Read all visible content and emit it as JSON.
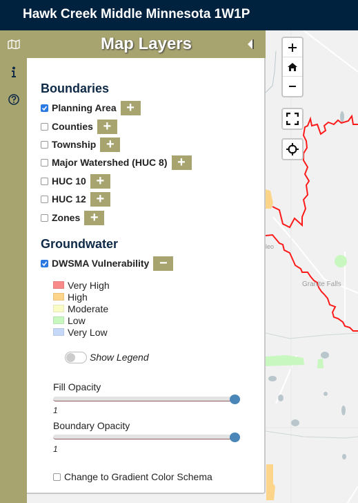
{
  "app": {
    "title": "Hawk Creek Middle Minnesota 1W1P"
  },
  "sidebar_icons": [
    {
      "name": "map-icon",
      "label": "Map Layers"
    },
    {
      "name": "info-icon",
      "label": "Info"
    },
    {
      "name": "help-icon",
      "label": "Help"
    }
  ],
  "panel": {
    "title": "Map Layers",
    "sections": {
      "boundaries": {
        "title": "Boundaries",
        "layers": [
          {
            "label": "Planning Area",
            "checked": true,
            "button": "+"
          },
          {
            "label": "Counties",
            "checked": false,
            "button": "+"
          },
          {
            "label": "Township",
            "checked": false,
            "button": "+"
          },
          {
            "label": "Major Watershed (HUC 8)",
            "checked": false,
            "button": "+"
          },
          {
            "label": "HUC 10",
            "checked": false,
            "button": "+"
          },
          {
            "label": "HUC 12",
            "checked": false,
            "button": "+"
          },
          {
            "label": "Zones",
            "checked": false,
            "button": "+"
          }
        ]
      },
      "groundwater": {
        "title": "Groundwater",
        "layers": [
          {
            "label": "DWSMA Vulnerability",
            "checked": true,
            "button": "−"
          }
        ],
        "legend": [
          {
            "label": "Very High",
            "color": "#f88a8a"
          },
          {
            "label": "High",
            "color": "#fdd58a"
          },
          {
            "label": "Moderate",
            "color": "#fafcc8"
          },
          {
            "label": "Low",
            "color": "#c8f7c0"
          },
          {
            "label": "Very Low",
            "color": "#c6d8f7"
          }
        ],
        "show_legend": {
          "label": "Show Legend",
          "on": false
        },
        "fill_opacity": {
          "label": "Fill Opacity",
          "value": "1"
        },
        "boundary_opacity": {
          "label": "Boundary Opacity",
          "value": "1"
        },
        "gradient": {
          "label": "Change to Gradient Color Schema",
          "checked": false
        }
      }
    }
  },
  "map": {
    "labels": {
      "town1": "Granite Falls",
      "town2": "leo"
    },
    "controls": [
      "zoom-in",
      "home",
      "zoom-out",
      "fullscreen",
      "locate"
    ],
    "colors": {
      "boundary": "#ff1a1a",
      "header": "#01223f",
      "accent": "#a8a470"
    }
  }
}
